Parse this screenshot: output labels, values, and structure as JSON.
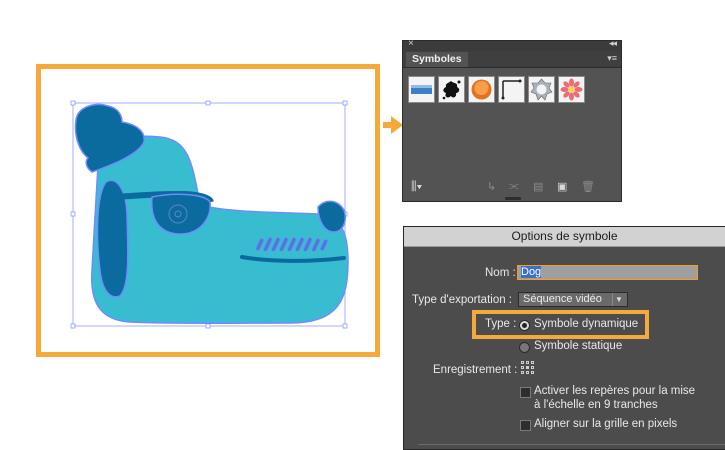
{
  "symbols_panel": {
    "tab_label": "Symboles",
    "symbols": [
      "blue-bar-symbol",
      "ink-splat-symbol",
      "orange-button-symbol",
      "corner-frame-symbol",
      "gear-ring-symbol",
      "pink-flower-symbol"
    ]
  },
  "dialog": {
    "title": "Options de symbole",
    "name_label": "Nom :",
    "name_value": "Dog",
    "export_label": "Type d'exportation :",
    "export_value": "Séquence vidéo",
    "type_label": "Type :",
    "type_option_dynamic": "Symbole dynamique",
    "type_option_static": "Symbole statique",
    "type_selected": "Symbole dynamique",
    "registration_label": "Enregistrement :",
    "checkbox_9slice": "Activer les repères pour la mise à l'échelle en 9 tranches",
    "checkbox_9slice_line1": "Activer les repères pour la mise",
    "checkbox_9slice_line2": "à l'échelle en 9 tranches",
    "checkbox_9slice_checked": false,
    "checkbox_pixel_grid": "Aligner sur la grille en pixels",
    "checkbox_pixel_grid_checked": false
  },
  "colors": {
    "highlight": "#f6a93b",
    "dog_body": "#38bdd0",
    "dog_dark": "#0b6a9e",
    "selection": "#6f8cff"
  }
}
